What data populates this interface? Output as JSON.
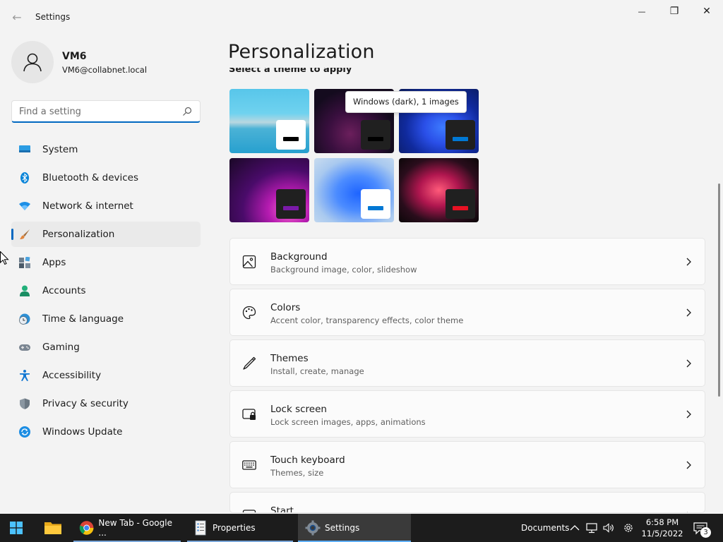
{
  "window": {
    "title": "Settings",
    "back_glyph": "←",
    "minimize_glyph": "—",
    "maximize_glyph": "❐",
    "close_glyph": "✕"
  },
  "profile": {
    "name": "VM6",
    "email": "VM6@collabnet.local"
  },
  "search": {
    "placeholder": "Find a setting",
    "value": ""
  },
  "nav": {
    "items": [
      {
        "label": "System",
        "icon": "monitor-icon",
        "active": false
      },
      {
        "label": "Bluetooth & devices",
        "icon": "bluetooth-icon",
        "active": false
      },
      {
        "label": "Network & internet",
        "icon": "wifi-icon",
        "active": false
      },
      {
        "label": "Personalization",
        "icon": "brush-icon",
        "active": true
      },
      {
        "label": "Apps",
        "icon": "apps-icon",
        "active": false
      },
      {
        "label": "Accounts",
        "icon": "person-icon",
        "active": false
      },
      {
        "label": "Time & language",
        "icon": "clock-globe-icon",
        "active": false
      },
      {
        "label": "Gaming",
        "icon": "gamepad-icon",
        "active": false
      },
      {
        "label": "Accessibility",
        "icon": "accessibility-icon",
        "active": false
      },
      {
        "label": "Privacy & security",
        "icon": "shield-icon",
        "active": false
      },
      {
        "label": "Windows Update",
        "icon": "update-icon",
        "active": false
      }
    ]
  },
  "main": {
    "title": "Personalization",
    "theme_heading": "Select a theme to apply",
    "tooltip": "Windows (dark), 1 images",
    "themes": [
      {
        "swatch_bg": "#ffffff",
        "accent": "#000000"
      },
      {
        "swatch_bg": "#202020",
        "accent": "#000000"
      },
      {
        "swatch_bg": "#202020",
        "accent": "#0078d4"
      },
      {
        "swatch_bg": "#202020",
        "accent": "#7a1aa8"
      },
      {
        "swatch_bg": "#ffffff",
        "accent": "#0078d4"
      },
      {
        "swatch_bg": "#202020",
        "accent": "#e81123"
      }
    ],
    "cards": [
      {
        "title": "Background",
        "subtitle": "Background image, color, slideshow",
        "icon": "image-icon"
      },
      {
        "title": "Colors",
        "subtitle": "Accent color, transparency effects, color theme",
        "icon": "palette-icon"
      },
      {
        "title": "Themes",
        "subtitle": "Install, create, manage",
        "icon": "pen-icon"
      },
      {
        "title": "Lock screen",
        "subtitle": "Lock screen images, apps, animations",
        "icon": "lock-screen-icon"
      },
      {
        "title": "Touch keyboard",
        "subtitle": "Themes, size",
        "icon": "keyboard-icon"
      },
      {
        "title": "Start",
        "subtitle": "",
        "icon": "start-menu-icon"
      }
    ]
  },
  "taskbar": {
    "items": [
      {
        "label": "New Tab - Google ...",
        "icon": "chrome-icon"
      },
      {
        "label": "Properties",
        "icon": "properties-icon"
      },
      {
        "label": "Settings",
        "icon": "settings-gear-icon"
      }
    ],
    "tray_label": "Documents",
    "time": "6:58 PM",
    "date": "11/5/2022",
    "notification_count": "3"
  },
  "colors": {
    "accent": "#0067c0",
    "taskbar": "#1c1c1c"
  }
}
